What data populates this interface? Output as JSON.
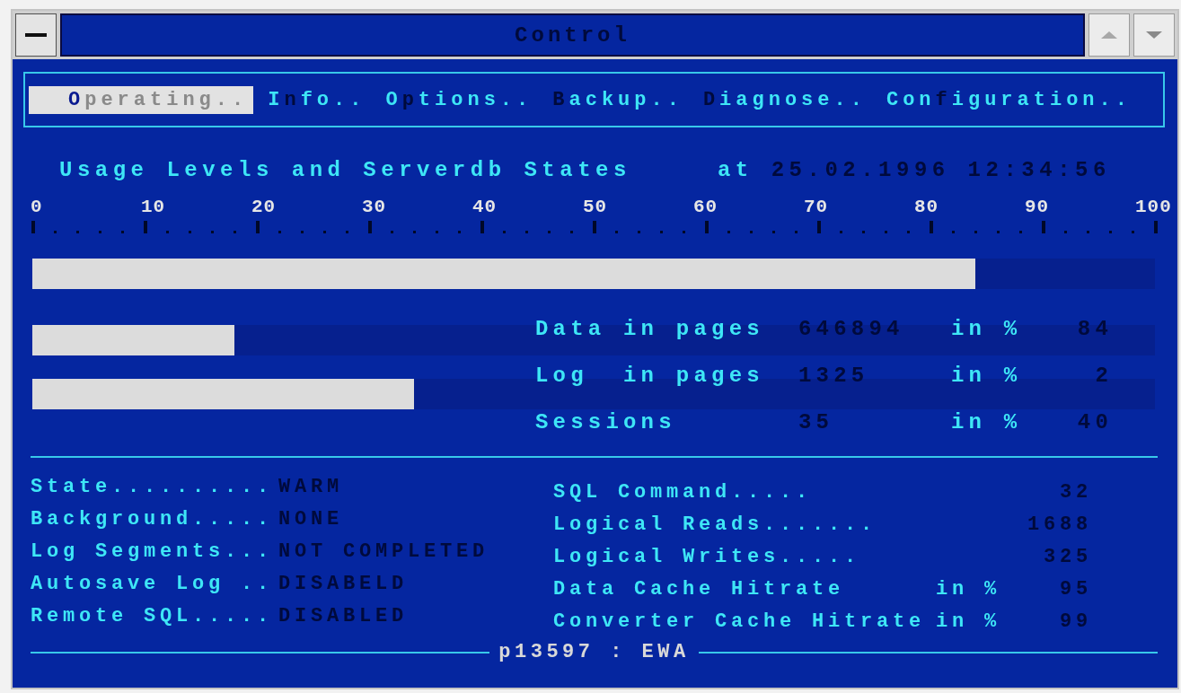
{
  "window": {
    "title": "Control"
  },
  "menu": [
    {
      "key": "O",
      "after": "perating..",
      "selected": true
    },
    {
      "before": "I",
      "key": "n",
      "after": "fo..",
      "selected": false
    },
    {
      "before": "O",
      "key": "p",
      "after": "tions..",
      "selected": false
    },
    {
      "key": "B",
      "after": "ackup..",
      "selected": false
    },
    {
      "key": "D",
      "after": "iagnose..",
      "selected": false
    },
    {
      "before": "Con",
      "key": "f",
      "after": "iguration..",
      "selected": false
    }
  ],
  "heading": {
    "title": "Usage Levels and Serverdb States",
    "at": "at",
    "timestamp": "25.02.1996 12:34:56"
  },
  "scale": [
    "0",
    "10",
    "20",
    "30",
    "40",
    "50",
    "60",
    "70",
    "80",
    "90",
    "100"
  ],
  "bars": [
    {
      "level": 0.84
    },
    {
      "level": 0.18
    },
    {
      "level": 0.34
    }
  ],
  "stats": [
    {
      "label": "Data in pages",
      "value": "646894",
      "unit": "in %",
      "percent": "84"
    },
    {
      "label": "Log  in pages",
      "value": "1325",
      "unit": "in %",
      "percent": "2"
    },
    {
      "label": "Sessions",
      "value": "35",
      "unit": "in %",
      "percent": "40"
    }
  ],
  "states": [
    {
      "label": "State..........",
      "value": "WARM"
    },
    {
      "label": "Background.....",
      "value": "NONE"
    },
    {
      "label": "Log Segments...",
      "value": "NOT COMPLETED"
    },
    {
      "label": "Autosave Log ..",
      "value": "DISABELD"
    },
    {
      "label": "Remote SQL.....",
      "value": "DISABLED"
    }
  ],
  "counters": [
    {
      "label": "SQL Command.....",
      "value": "32"
    },
    {
      "label": "Logical Reads.......",
      "value": "1688"
    },
    {
      "label": "Logical Writes.....",
      "value": "325"
    },
    {
      "label": "Data Cache Hitrate",
      "unit": "in %",
      "value": "95"
    },
    {
      "label": "Converter Cache Hitrate",
      "unit": "in %",
      "value": "99"
    }
  ],
  "footer": "p13597 : EWA"
}
